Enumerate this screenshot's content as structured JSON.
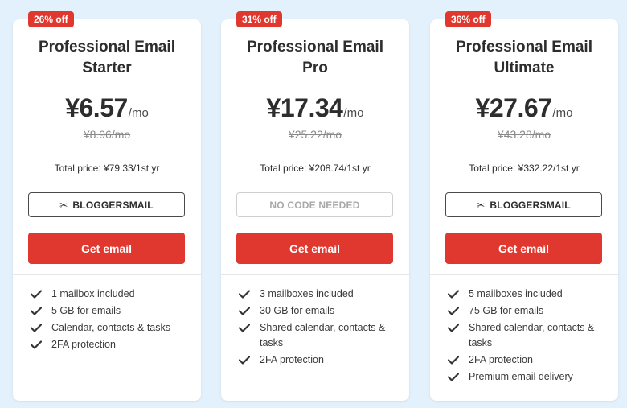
{
  "plans": [
    {
      "badge": "26% off",
      "title": "Professional Email Starter",
      "price": "¥6.57",
      "period": "/mo",
      "old_price": "¥8.96/mo",
      "total": "Total price: ¥79.33/1st yr",
      "coupon": "BLOGGERSMAIL",
      "cta": "Get email",
      "features": [
        "1 mailbox included",
        "5 GB for emails",
        "Calendar, contacts & tasks",
        "2FA protection"
      ]
    },
    {
      "badge": "31% off",
      "title": "Professional Email Pro",
      "price": "¥17.34",
      "period": "/mo",
      "old_price": "¥25.22/mo",
      "total": "Total price: ¥208.74/1st yr",
      "coupon": "NO CODE NEEDED",
      "cta": "Get email",
      "features": [
        "3 mailboxes included",
        "30 GB for emails",
        "Shared calendar, contacts & tasks",
        "2FA protection"
      ]
    },
    {
      "badge": "36% off",
      "title": "Professional Email Ultimate",
      "price": "¥27.67",
      "period": "/mo",
      "old_price": "¥43.28/mo",
      "total": "Total price: ¥332.22/1st yr",
      "coupon": "BLOGGERSMAIL",
      "cta": "Get email",
      "features": [
        "5 mailboxes included",
        "75 GB for emails",
        "Shared calendar, contacts & tasks",
        "2FA protection",
        "Premium email delivery"
      ]
    }
  ],
  "icons": {
    "coupon": "scissors-icon",
    "feature": "checkmark-icon"
  },
  "colors": {
    "accent": "#e0382f",
    "background": "#e3f1fc",
    "card": "#ffffff"
  }
}
